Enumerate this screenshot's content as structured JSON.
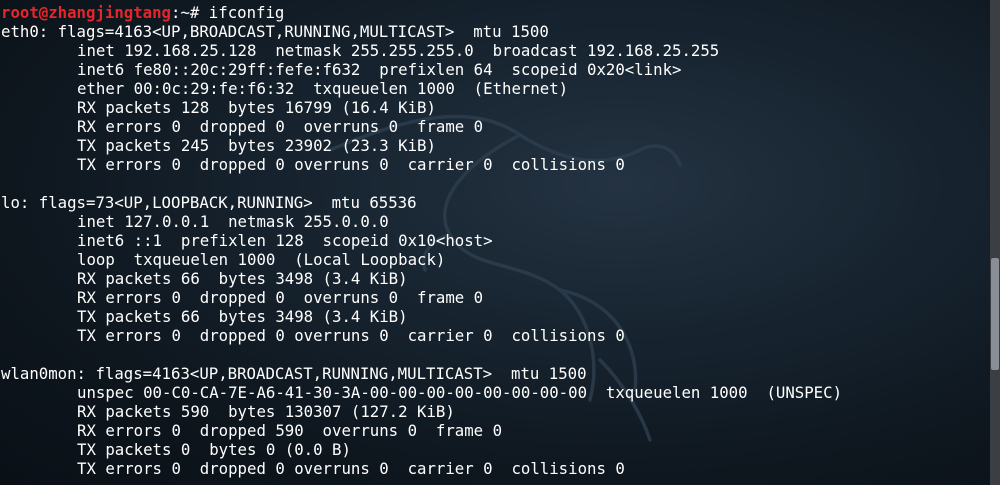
{
  "prompt": {
    "user_host": "root@zhangjingtang",
    "path": ":~#",
    "command": " ifconfig"
  },
  "interfaces": [
    {
      "header": "eth0: flags=4163<UP,BROADCAST,RUNNING,MULTICAST>  mtu 1500",
      "lines": [
        "inet 192.168.25.128  netmask 255.255.255.0  broadcast 192.168.25.255",
        "inet6 fe80::20c:29ff:fefe:f632  prefixlen 64  scopeid 0x20<link>",
        "ether 00:0c:29:fe:f6:32  txqueuelen 1000  (Ethernet)",
        "RX packets 128  bytes 16799 (16.4 KiB)",
        "RX errors 0  dropped 0  overruns 0  frame 0",
        "TX packets 245  bytes 23902 (23.3 KiB)",
        "TX errors 0  dropped 0 overruns 0  carrier 0  collisions 0"
      ]
    },
    {
      "header": "lo: flags=73<UP,LOOPBACK,RUNNING>  mtu 65536",
      "lines": [
        "inet 127.0.0.1  netmask 255.0.0.0",
        "inet6 ::1  prefixlen 128  scopeid 0x10<host>",
        "loop  txqueuelen 1000  (Local Loopback)",
        "RX packets 66  bytes 3498 (3.4 KiB)",
        "RX errors 0  dropped 0  overruns 0  frame 0",
        "TX packets 66  bytes 3498 (3.4 KiB)",
        "TX errors 0  dropped 0 overruns 0  carrier 0  collisions 0"
      ]
    },
    {
      "header": "wlan0mon: flags=4163<UP,BROADCAST,RUNNING,MULTICAST>  mtu 1500",
      "lines": [
        "unspec 00-C0-CA-7E-A6-41-30-3A-00-00-00-00-00-00-00-00  txqueuelen 1000  (UNSPEC)",
        "RX packets 590  bytes 130307 (127.2 KiB)",
        "RX errors 0  dropped 590  overruns 0  frame 0",
        "TX packets 0  bytes 0 (0.0 B)",
        "TX errors 0  dropped 0 overruns 0  carrier 0  collisions 0"
      ]
    }
  ],
  "colors": {
    "prompt_user": "#e5262c",
    "text": "#ffffff",
    "background": "#172430"
  }
}
